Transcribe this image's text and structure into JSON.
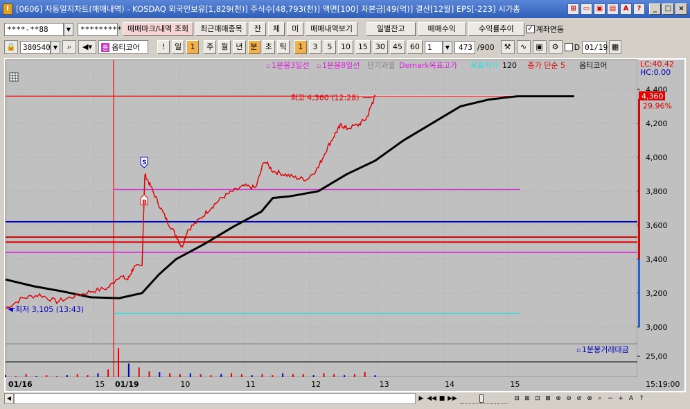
{
  "window": {
    "title": "[0606] 자동일지차트(매매내역) - KOSDAQ 외국인보유[1,829(천)] 주식수[48,793(천)] 액면[100] 자본금[49(억)] 결산[12월] EPS[-223] 시가총",
    "icon_label": "I"
  },
  "toolbar1": {
    "account_value": "****-**88",
    "password_value": "*********",
    "btn_trade_mark": "매매마크/내역 조회",
    "btn_recent_items": "최근매매종목",
    "btn_jan": "잔",
    "btn_che": "체",
    "btn_mi": "미",
    "btn_history": "매매내역보기",
    "btn_daily_balance": "일별잔고",
    "btn_trade_profit": "매매수익",
    "btn_return_trend": "수익률추이",
    "chk_account_link_label": "계좌연동",
    "chk_account_link_checked": true
  },
  "toolbar2": {
    "stock_code": "380540",
    "stock_name": "옵티코어",
    "period_buttons": [
      "일",
      "주",
      "월",
      "년",
      "분",
      "초",
      "틱"
    ],
    "period_selected": "분",
    "interval_buttons": [
      "1",
      "3",
      "5",
      "10",
      "15",
      "30",
      "45",
      "60"
    ],
    "interval_selected": "1",
    "multiplier": "1",
    "count": "473",
    "count_total": "/900",
    "chk_d_label": "D",
    "date_value": "01/19"
  },
  "chart_data": [
    {
      "type": "line",
      "role": "price",
      "legend": [
        {
          "name": "1분봉3일선",
          "color": "#e020e0"
        },
        {
          "name": "1분봉8일선",
          "color": "#e020e0"
        },
        {
          "name": "단기과열",
          "color": "#808080"
        },
        {
          "name": "Demark목표고가",
          "color": "#e020e0"
        },
        {
          "name": "목표저가",
          "color": "#20e0e0"
        },
        {
          "name": "120",
          "color": "#000000"
        },
        {
          "name": "종가 단순 5",
          "color": "#e00000"
        },
        {
          "name": "옵티코어",
          "color": "#000000"
        }
      ],
      "y_ticks": [
        "4,400",
        "4,200",
        "4,000",
        "3,800",
        "3,600",
        "3,400",
        "3,200",
        "3,000"
      ],
      "ylim": [
        2950,
        4420
      ],
      "x_ticks": [
        "01/16",
        "15",
        "01/19",
        "10",
        "11",
        "12",
        "13",
        "14",
        "15"
      ],
      "x_axis_end": "15:19:00",
      "lc_label": "LC:40.42",
      "hc_label": "HC:0.00",
      "current_price_label": "4,360",
      "current_change_label": "29.96%",
      "high_annotation": "최고 4,360 (12:28)",
      "low_annotation": "최저 3,105 (13:43)",
      "buy_marker": "B",
      "sell_marker": "S",
      "horizontal_lines": [
        {
          "value": 4360,
          "color": "#e00000"
        },
        {
          "value": 3810,
          "color": "#e020e0"
        },
        {
          "value": 3620,
          "color": "#0000c0"
        },
        {
          "value": 3530,
          "color": "#e00000"
        },
        {
          "value": 3500,
          "color": "#e00000"
        },
        {
          "value": 3440,
          "color": "#e020e0"
        },
        {
          "value": 3080,
          "color": "#20e0e0"
        }
      ],
      "price_series": [
        [
          0.0,
          3110
        ],
        [
          0.03,
          3170
        ],
        [
          0.06,
          3190
        ],
        [
          0.09,
          3150
        ],
        [
          0.12,
          3180
        ],
        [
          0.15,
          3210
        ],
        [
          0.18,
          3230
        ],
        [
          0.2,
          3300
        ],
        [
          0.215,
          3280
        ],
        [
          0.225,
          3350
        ],
        [
          0.24,
          3360
        ],
        [
          0.245,
          3900
        ],
        [
          0.255,
          3830
        ],
        [
          0.27,
          3720
        ],
        [
          0.285,
          3620
        ],
        [
          0.3,
          3540
        ],
        [
          0.31,
          3470
        ],
        [
          0.32,
          3570
        ],
        [
          0.34,
          3630
        ],
        [
          0.36,
          3700
        ],
        [
          0.38,
          3760
        ],
        [
          0.4,
          3800
        ],
        [
          0.42,
          3830
        ],
        [
          0.44,
          3820
        ],
        [
          0.455,
          3980
        ],
        [
          0.47,
          3920
        ],
        [
          0.49,
          3900
        ],
        [
          0.51,
          3880
        ],
        [
          0.53,
          3870
        ],
        [
          0.55,
          3940
        ],
        [
          0.565,
          4050
        ],
        [
          0.58,
          4140
        ],
        [
          0.59,
          4190
        ],
        [
          0.6,
          4170
        ],
        [
          0.62,
          4190
        ],
        [
          0.635,
          4230
        ],
        [
          0.645,
          4320
        ],
        [
          0.65,
          4360
        ]
      ],
      "ma_series": [
        [
          0.0,
          3280
        ],
        [
          0.05,
          3240
        ],
        [
          0.1,
          3210
        ],
        [
          0.15,
          3175
        ],
        [
          0.2,
          3170
        ],
        [
          0.24,
          3200
        ],
        [
          0.27,
          3310
        ],
        [
          0.3,
          3400
        ],
        [
          0.35,
          3490
        ],
        [
          0.4,
          3590
        ],
        [
          0.45,
          3680
        ],
        [
          0.47,
          3760
        ],
        [
          0.5,
          3770
        ],
        [
          0.55,
          3800
        ],
        [
          0.6,
          3900
        ],
        [
          0.65,
          3980
        ],
        [
          0.7,
          4100
        ],
        [
          0.75,
          4200
        ],
        [
          0.8,
          4300
        ],
        [
          0.85,
          4340
        ],
        [
          0.9,
          4360
        ],
        [
          1.0,
          4360
        ]
      ]
    },
    {
      "type": "bar",
      "role": "volume",
      "legend": [
        {
          "name": "1분봉거래대금",
          "color": "#0000c0"
        }
      ],
      "y_ticks": [
        "25,00"
      ],
      "volumes": [
        2,
        1,
        3,
        1,
        2,
        1,
        2,
        3,
        2,
        4,
        8,
        30,
        14,
        10,
        6,
        5,
        4,
        3,
        4,
        3,
        2,
        3,
        4,
        3,
        2,
        3,
        2,
        4,
        3,
        3,
        2,
        4,
        3,
        2,
        3,
        5,
        2
      ]
    }
  ],
  "bottombar": {
    "controls": [
      "▶",
      "◀◀",
      "■",
      "▶▶"
    ],
    "tool_icons": [
      "⊟",
      "⊞",
      "⊡",
      "⊠",
      "⊕",
      "⊖",
      "⊘",
      "⊗",
      "⌕",
      "−",
      "+",
      "A",
      "?"
    ]
  }
}
